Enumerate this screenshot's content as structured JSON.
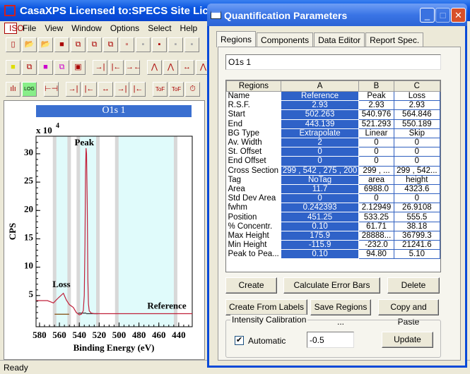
{
  "app": {
    "title": "CasaXPS Licensed to:SPECS Site License - [O1s 1]",
    "menu": [
      "File",
      "View",
      "Window",
      "Options",
      "Select",
      "Help"
    ],
    "toolbar1": [
      "new",
      "open",
      "open-folder",
      "save",
      "copy",
      "copy-red",
      "copy-blue",
      "page",
      "disabled1",
      "grid-red",
      "disabled2",
      "disabled3"
    ],
    "toolbar2": [
      "yellow-square",
      "overlay",
      "magenta-square",
      "magenta-overlay",
      "frame",
      "right-bracket",
      "left-bracket",
      "contract",
      "peak-right",
      "peak-left",
      "expand",
      "peak-up"
    ],
    "toolbar3": [
      "spectrum",
      "log",
      "hbar",
      "region-right",
      "region-left",
      "expand-h",
      "limit-right",
      "limit-left",
      "tof-calib",
      "tof-calib-x",
      "clock-arrow"
    ],
    "status": "Ready"
  },
  "plot": {
    "title": "O1s 1"
  },
  "chart_data": {
    "type": "line",
    "xlabel": "Binding Energy (eV)",
    "ylabel": "CPS",
    "yscale_label": "x 10",
    "yscale_exp": "4",
    "xlim": [
      583.5,
      426.4
    ],
    "ylim": [
      -0.5,
      33.1
    ],
    "xticks": [
      580,
      560,
      540,
      520,
      500,
      480,
      460,
      440
    ],
    "yticks": [
      5,
      10,
      15,
      20,
      25,
      30
    ],
    "regions": [
      {
        "name": "Loss",
        "start": 564.846,
        "end": 550.189
      },
      {
        "name": "Peak",
        "start": 540.976,
        "end": 521.293
      },
      {
        "name": "Reference",
        "start": 502.263,
        "end": 443.139
      }
    ],
    "region_labels": [
      {
        "text": "Loss",
        "x": 558,
        "y": 6.5
      },
      {
        "text": "Peak",
        "x": 535,
        "y": 31.5
      },
      {
        "text": "Reference",
        "x": 452,
        "y": 2.7
      }
    ],
    "series": [
      {
        "color": "#c0203a",
        "x": [
          583.5,
          572,
          566,
          561,
          556,
          553,
          550,
          546,
          543,
          540,
          538,
          536,
          535,
          534.3,
          533.7,
          533.2,
          532.7,
          532,
          531.4,
          530.8,
          530,
          528,
          525,
          520,
          500,
          426.4
        ],
        "y": [
          4.1,
          4.1,
          3.7,
          4.6,
          5.4,
          4.2,
          3.4,
          2.9,
          2.0,
          1.6,
          1.7,
          2.3,
          5,
          14,
          27,
          31,
          30,
          21,
          8,
          3.5,
          2.3,
          1.9,
          1.8,
          1.8,
          1.8,
          1.8
        ]
      }
    ],
    "backgrounds": [
      {
        "color": "#8a5a20",
        "x": [
          564.8,
          550.2
        ],
        "y": [
          1.7,
          1.7
        ]
      },
      {
        "color": "#333",
        "x": [
          541,
          533
        ],
        "y": [
          1.9,
          1.9
        ]
      },
      {
        "color": "#333",
        "x": [
          533,
          521.3
        ],
        "y": [
          1.8,
          1.8
        ]
      }
    ]
  },
  "dialog": {
    "title": "Quantification Parameters",
    "tabs": [
      "Regions",
      "Components",
      "Data Editor",
      "Report Spec."
    ],
    "active_tab": "Regions",
    "name_field": "O1s 1",
    "columns": [
      "Regions",
      "A",
      "B",
      "C"
    ],
    "rows": [
      [
        "Name",
        "Reference",
        "Peak",
        "Loss"
      ],
      [
        "R.S.F.",
        "2.93",
        "2.93",
        "2.93"
      ],
      [
        "Start",
        "502.263",
        "540.976",
        "564.846"
      ],
      [
        "End",
        "443.139",
        "521.293",
        "550.189"
      ],
      [
        "BG Type",
        "Extrapolate",
        "Linear",
        "Skip"
      ],
      [
        "Av. Width",
        "2",
        "0",
        "0"
      ],
      [
        "St. Offset",
        "0",
        "0",
        "0"
      ],
      [
        "End Offset",
        "0",
        "0",
        "0"
      ],
      [
        "Cross Section",
        "299 , 542 , 275 , 200",
        "299 , ...",
        "299 , 542..."
      ],
      [
        "Tag",
        "NoTag",
        "area",
        "height"
      ],
      [
        "Area",
        "11.7",
        "6988.0",
        "4323.6"
      ],
      [
        "Std Dev Area",
        "0",
        "0",
        "0"
      ],
      [
        "fwhm",
        "0.242393",
        "2.12949",
        "26.9108"
      ],
      [
        "Position",
        "451.25",
        "533.25",
        "555.5"
      ],
      [
        "% Concentr.",
        "0.10",
        "61.71",
        "38.18"
      ],
      [
        "Max Height",
        "175.9",
        "28888...",
        "36799.3"
      ],
      [
        "Min Height",
        "-115.9",
        "-232.0",
        "21241.6"
      ],
      [
        "Peak to Pea...",
        "0.10",
        "94.80",
        "5.10"
      ]
    ],
    "buttons": {
      "create": "Create",
      "calc_error": "Calculate Error Bars",
      "delete": "Delete",
      "create_labels": "Create From Labels",
      "save_regions": "Save Regions ...",
      "copy_paste": "Copy and Paste",
      "update": "Update"
    },
    "intensity": {
      "label": "Intensity Calibration",
      "automatic_label": "Automatic",
      "automatic": true,
      "value": "-0.5"
    }
  }
}
